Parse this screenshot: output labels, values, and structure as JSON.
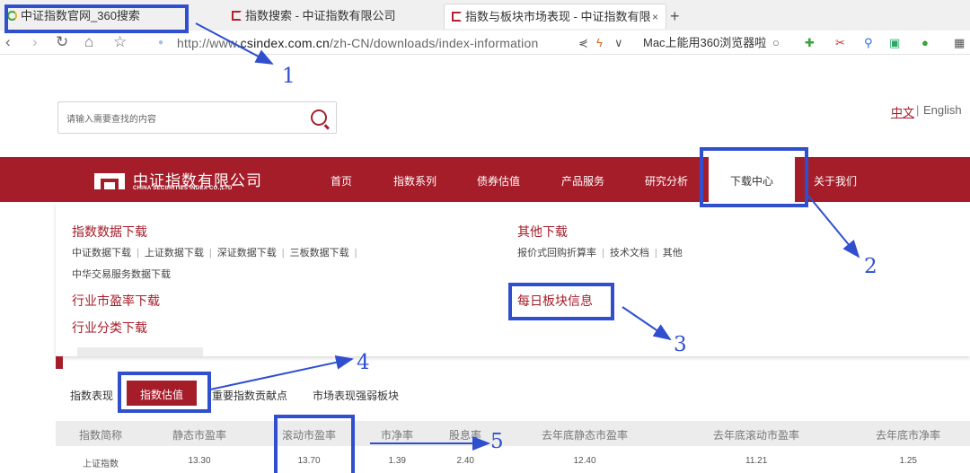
{
  "browser": {
    "tabs": [
      {
        "label": "中证指数官网_360搜索",
        "icon": "360-search-icon"
      },
      {
        "label": "指数搜索 - 中证指数有限公司",
        "icon": "csi-logo-icon"
      },
      {
        "label": "指数与板块市场表现 - 中证指数有限",
        "icon": "csi-logo-icon"
      }
    ],
    "tab_close": "×",
    "new_tab": "+",
    "url_prefix": "http://www.",
    "url_domain": "csindex.com.cn",
    "url_path": "/zh-CN/downloads/index-information",
    "search_hint": "Mac上能用360浏览器啦"
  },
  "site": {
    "search_placeholder": "请输入需要查找的内容",
    "lang_zh": "中文",
    "lang_sep": "|",
    "lang_en": "English",
    "logo_cn": "中证指数有限公司",
    "logo_en": "CHINA SECURITIES INDEX CO.,LTD",
    "nav": [
      "首页",
      "指数系列",
      "债券估值",
      "产品服务",
      "研究分析",
      "下载中心",
      "关于我们"
    ]
  },
  "dropdown": {
    "index_data_title": "指数数据下载",
    "index_data_links": [
      "中证数据下载",
      "上证数据下载",
      "深证数据下载",
      "三板数据下载"
    ],
    "index_data_link2": "中华交易服务数据下载",
    "industry_pe": "行业市盈率下载",
    "industry_class": "行业分类下载",
    "other_title": "其他下载",
    "other_links": [
      "报价式回购折算率",
      "技术文档",
      "其他"
    ],
    "daily_sector": "每日板块信息"
  },
  "subtabs": [
    "指数表现",
    "指数估值",
    "重要指数贡献点",
    "市场表现强弱板块"
  ],
  "chart_data": {
    "type": "table",
    "columns": [
      "指数简称",
      "静态市盈率",
      "滚动市盈率",
      "市净率",
      "股息率",
      "去年底静态市盈率",
      "去年底滚动市盈率",
      "去年底市净率"
    ],
    "rows": [
      [
        "上证指数",
        "13.30",
        "13.70",
        "1.39",
        "2.40",
        "12.40",
        "11.21",
        "1.25"
      ]
    ]
  },
  "annotations": [
    "1",
    "2",
    "3",
    "4",
    "5"
  ],
  "colors": {
    "brand": "#a61d2a",
    "annotation": "#2f4fcf"
  }
}
